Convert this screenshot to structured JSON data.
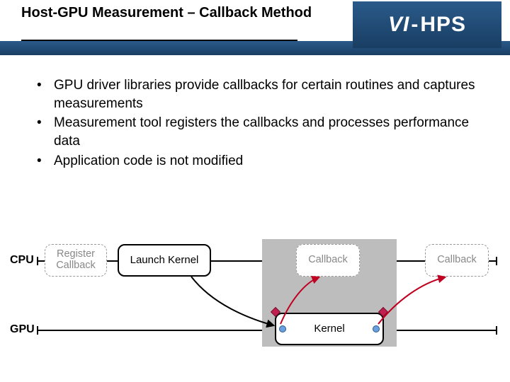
{
  "header": {
    "title": "Host-GPU Measurement – Callback Method",
    "logo": {
      "vi": "VI",
      "dash": "-",
      "hps": "HPS"
    }
  },
  "bullets": [
    "GPU driver libraries provide callbacks for certain routines and captures measurements",
    "Measurement tool registers the callbacks and processes performance data",
    "Application code is not modified"
  ],
  "diagram": {
    "lanes": {
      "cpu": "CPU",
      "gpu": "GPU"
    },
    "boxes": {
      "register": "Register\nCallback",
      "launch": "Launch Kernel",
      "callback1": "Callback",
      "callback2": "Callback",
      "kernel": "Kernel"
    }
  }
}
